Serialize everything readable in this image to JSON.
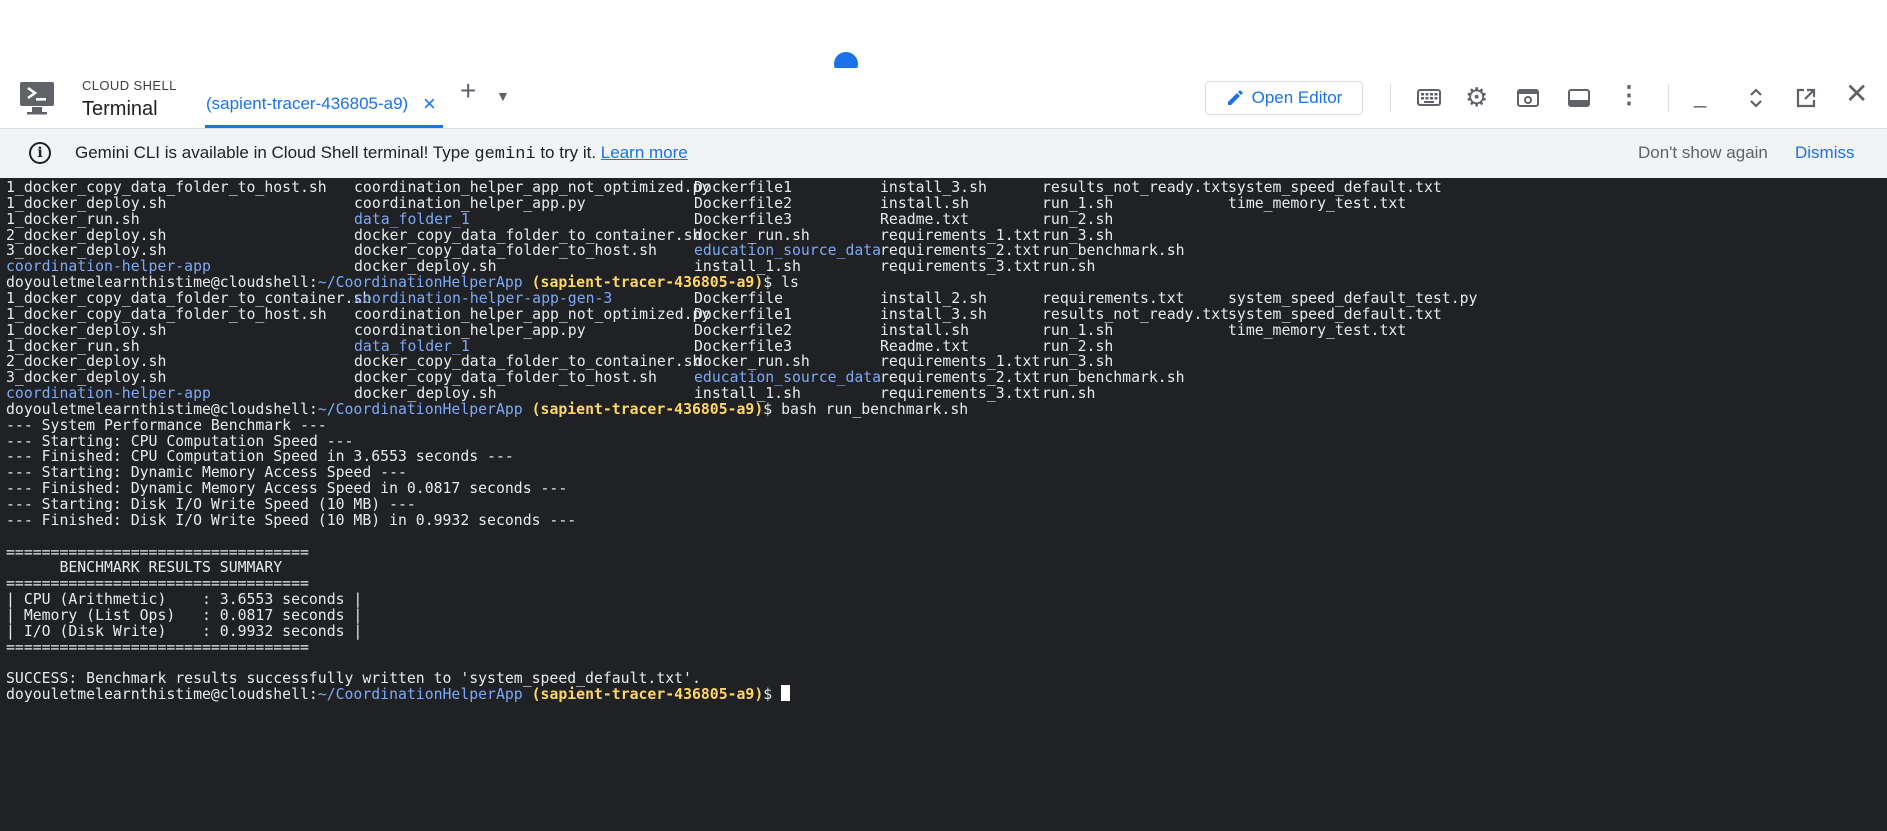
{
  "header": {
    "cloud_shell_label": "CLOUD SHELL",
    "terminal_label": "Terminal",
    "tab_title": "(sapient-tracer-436805-a9)",
    "open_editor_label": "Open Editor"
  },
  "banner": {
    "text_before": "Gemini CLI is available in Cloud Shell terminal! Type ",
    "command": "gemini",
    "text_after": " to try it. ",
    "learn_more": "Learn more",
    "dont_show_again": "Don't show again",
    "dismiss": "Dismiss"
  },
  "colors": {
    "accent": "#1a73e8",
    "terminal_bg": "#202124",
    "prompt_project": "#fdd663",
    "directory": "#7baaf7"
  },
  "icons": [
    "cloud-shell-icon",
    "close-icon",
    "add-icon",
    "dropdown-icon",
    "pencil-icon",
    "keyboard-icon",
    "gear-icon",
    "web-preview-icon",
    "layout-icon",
    "more-vert-icon",
    "minimize-icon",
    "expand-icon",
    "open-new-window-icon",
    "close-icon"
  ],
  "terminal": {
    "prompt_user": "doyouletmelearnthistime@cloudshell:",
    "prompt_path": "~/CoordinationHelperApp",
    "prompt_project": "(sapient-tracer-436805-a9)",
    "listing1": [
      [
        {
          "t": "1_docker_copy_data_folder_to_host.sh"
        },
        {
          "t": "coordination_helper_app_not_optimized.py"
        },
        {
          "t": "Dockerfile1"
        },
        {
          "t": "install_3.sh"
        },
        {
          "t": "results_not_ready.txt"
        },
        {
          "t": "system_speed_default.txt"
        }
      ],
      [
        {
          "t": "1_docker_deploy.sh"
        },
        {
          "t": "coordination_helper_app.py"
        },
        {
          "t": "Dockerfile2"
        },
        {
          "t": "install.sh"
        },
        {
          "t": "run_1.sh"
        },
        {
          "t": "time_memory_test.txt"
        }
      ],
      [
        {
          "t": "1_docker_run.sh"
        },
        {
          "t": "data_folder_1",
          "dir": true
        },
        {
          "t": "Dockerfile3"
        },
        {
          "t": "Readme.txt"
        },
        {
          "t": "run_2.sh"
        },
        {
          "t": ""
        }
      ],
      [
        {
          "t": "2_docker_deploy.sh"
        },
        {
          "t": "docker_copy_data_folder_to_container.sh"
        },
        {
          "t": "docker_run.sh"
        },
        {
          "t": "requirements_1.txt"
        },
        {
          "t": "run_3.sh"
        },
        {
          "t": ""
        }
      ],
      [
        {
          "t": "3_docker_deploy.sh"
        },
        {
          "t": "docker_copy_data_folder_to_host.sh"
        },
        {
          "t": "education_source_data",
          "dir": true
        },
        {
          "t": "requirements_2.txt"
        },
        {
          "t": "run_benchmark.sh"
        },
        {
          "t": ""
        }
      ],
      [
        {
          "t": "coordination-helper-app",
          "dir": true
        },
        {
          "t": "docker_deploy.sh"
        },
        {
          "t": "install_1.sh"
        },
        {
          "t": "requirements_3.txt"
        },
        {
          "t": "run.sh"
        },
        {
          "t": ""
        }
      ]
    ],
    "command1": "ls",
    "listing2": [
      [
        {
          "t": "1_docker_copy_data_folder_to_container.sh"
        },
        {
          "t": "coordination-helper-app-gen-3",
          "dir": true
        },
        {
          "t": "Dockerfile"
        },
        {
          "t": "install_2.sh"
        },
        {
          "t": "requirements.txt"
        },
        {
          "t": "system_speed_default_test.py"
        }
      ],
      [
        {
          "t": "1_docker_copy_data_folder_to_host.sh"
        },
        {
          "t": "coordination_helper_app_not_optimized.py"
        },
        {
          "t": "Dockerfile1"
        },
        {
          "t": "install_3.sh"
        },
        {
          "t": "results_not_ready.txt"
        },
        {
          "t": "system_speed_default.txt"
        }
      ],
      [
        {
          "t": "1_docker_deploy.sh"
        },
        {
          "t": "coordination_helper_app.py"
        },
        {
          "t": "Dockerfile2"
        },
        {
          "t": "install.sh"
        },
        {
          "t": "run_1.sh"
        },
        {
          "t": "time_memory_test.txt"
        }
      ],
      [
        {
          "t": "1_docker_run.sh"
        },
        {
          "t": "data_folder_1",
          "dir": true
        },
        {
          "t": "Dockerfile3"
        },
        {
          "t": "Readme.txt"
        },
        {
          "t": "run_2.sh"
        },
        {
          "t": ""
        }
      ],
      [
        {
          "t": "2_docker_deploy.sh"
        },
        {
          "t": "docker_copy_data_folder_to_container.sh"
        },
        {
          "t": "docker_run.sh"
        },
        {
          "t": "requirements_1.txt"
        },
        {
          "t": "run_3.sh"
        },
        {
          "t": ""
        }
      ],
      [
        {
          "t": "3_docker_deploy.sh"
        },
        {
          "t": "docker_copy_data_folder_to_host.sh"
        },
        {
          "t": "education_source_data",
          "dir": true
        },
        {
          "t": "requirements_2.txt"
        },
        {
          "t": "run_benchmark.sh"
        },
        {
          "t": ""
        }
      ],
      [
        {
          "t": "coordination-helper-app",
          "dir": true
        },
        {
          "t": "docker_deploy.sh"
        },
        {
          "t": "install_1.sh"
        },
        {
          "t": "requirements_3.txt"
        },
        {
          "t": "run.sh"
        },
        {
          "t": ""
        }
      ]
    ],
    "command2": "bash run_benchmark.sh",
    "output": [
      "--- System Performance Benchmark ---",
      "--- Starting: CPU Computation Speed ---",
      "--- Finished: CPU Computation Speed in 3.6553 seconds ---",
      "--- Starting: Dynamic Memory Access Speed ---",
      "--- Finished: Dynamic Memory Access Speed in 0.0817 seconds ---",
      "--- Starting: Disk I/O Write Speed (10 MB) ---",
      "--- Finished: Disk I/O Write Speed (10 MB) in 0.9932 seconds ---",
      "",
      "==================================",
      "      BENCHMARK RESULTS SUMMARY",
      "==================================",
      "| CPU (Arithmetic)    : 3.6553 seconds |",
      "| Memory (List Ops)   : 0.0817 seconds |",
      "| I/O (Disk Write)    : 0.9932 seconds |",
      "==================================",
      "",
      "SUCCESS: Benchmark results successfully written to 'system_speed_default.txt'."
    ]
  }
}
